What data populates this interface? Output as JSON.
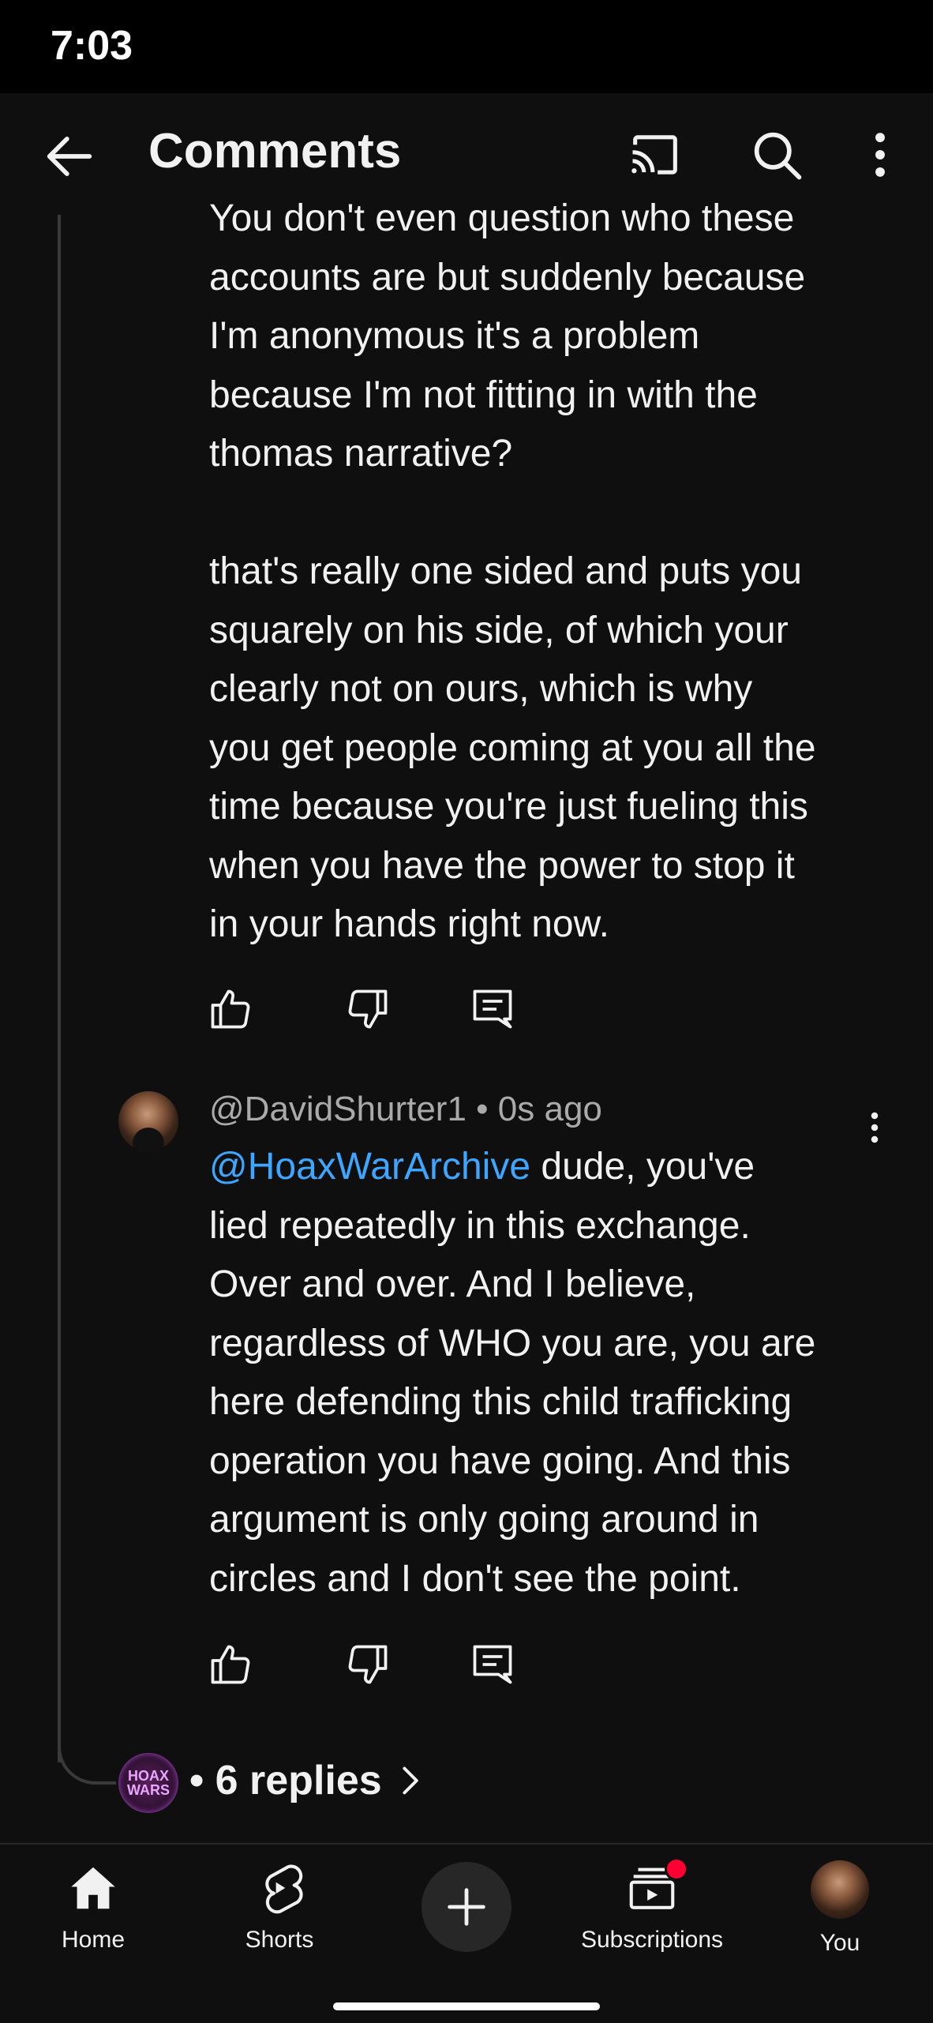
{
  "status_bar": {
    "time": "7:03"
  },
  "header": {
    "title": "Comments"
  },
  "comments": [
    {
      "text": "You don't even question who these\naccounts are but suddenly because\nI'm anonymous it's a problem\nbecause I'm not fitting in with the\nthomas narrative?\n\nthat's really one sided and puts you\nsquarely on his side, of which your\nclearly not on ours, which is why\nyou get people coming at you all the\ntime because you're just fueling this\nwhen you have the power to stop it\nin your hands right now."
    },
    {
      "author": "@DavidShurter1",
      "separator": "•",
      "time_ago": "0s ago",
      "mention": "@HoaxWarArchive",
      "text": " dude, you've\nlied repeatedly in this exchange.\nOver and over. And I believe,\nregardless of WHO you are, you are\nhere defending this child trafficking\noperation you have going. And this\nargument is only going around in\ncircles and I don't see the point."
    }
  ],
  "replies": {
    "avatar_text": [
      "HOAX",
      "WARS"
    ],
    "label": "• 6 replies"
  },
  "bottom_nav": {
    "home": "Home",
    "shorts": "Shorts",
    "subscriptions": "Subscriptions",
    "you": "You"
  },
  "colors": {
    "background": "#0f0f0f",
    "mention": "#3ea6ff",
    "notification_dot": "#ff0033"
  }
}
